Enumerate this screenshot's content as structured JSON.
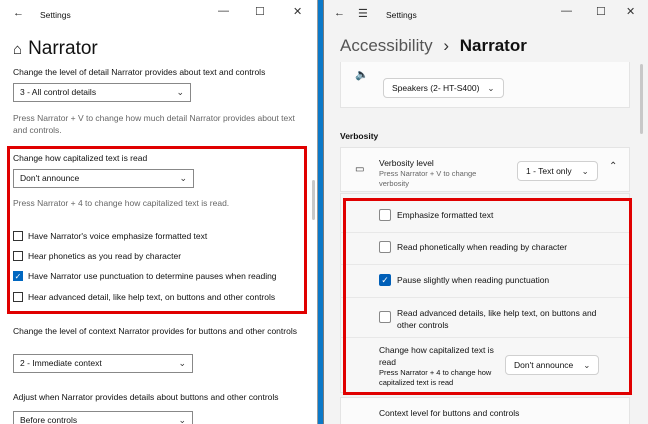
{
  "left": {
    "title": "Settings",
    "heading": "Narrator",
    "detail_label": "Change the level of detail Narrator provides about text and controls",
    "detail_value": "3 - All control details",
    "detail_hint": "Press Narrator + V to change how much detail Narrator provides about text and controls.",
    "cap_label": "Change how capitalized text is read",
    "cap_value": "Don't announce",
    "cap_hint": "Press Narrator + 4 to change how capitalized text is read.",
    "checkboxes": [
      {
        "label": "Have Narrator's voice emphasize formatted text",
        "checked": false
      },
      {
        "label": "Hear phonetics as you read by character",
        "checked": false
      },
      {
        "label": "Have Narrator use punctuation to determine pauses when reading",
        "checked": true
      },
      {
        "label": "Hear advanced detail, like help text, on buttons and other controls",
        "checked": false
      }
    ],
    "context_label": "Change the level of context Narrator provides for buttons and other controls",
    "context_value": "2 - Immediate context",
    "adjust_label": "Adjust when Narrator provides details about buttons and other controls",
    "adjust_value": "Before controls"
  },
  "right": {
    "title": "Settings",
    "bread_parent": "Accessibility",
    "bread_sep": "›",
    "bread_current": "Narrator",
    "speaker_value": "Speakers (2- HT-S400)",
    "section": "Verbosity",
    "verbosity_title": "Verbosity level",
    "verbosity_sub": "Press Narrator + V to change verbosity",
    "verbosity_value": "1 - Text only",
    "items": [
      {
        "label": "Emphasize formatted text",
        "checked": false
      },
      {
        "label": "Read phonetically when reading by character",
        "checked": false
      },
      {
        "label": "Pause slightly when reading punctuation",
        "checked": true
      },
      {
        "label": "Read advanced details, like help text, on buttons and other controls",
        "checked": false
      }
    ],
    "cap_title": "Change how capitalized text is read",
    "cap_sub": "Press Narrator + 4 to change how capitalized text is read",
    "cap_value": "Don't announce",
    "context_title": "Context level for buttons and controls"
  },
  "accent": "#0067c0",
  "highlight": "#e00000"
}
